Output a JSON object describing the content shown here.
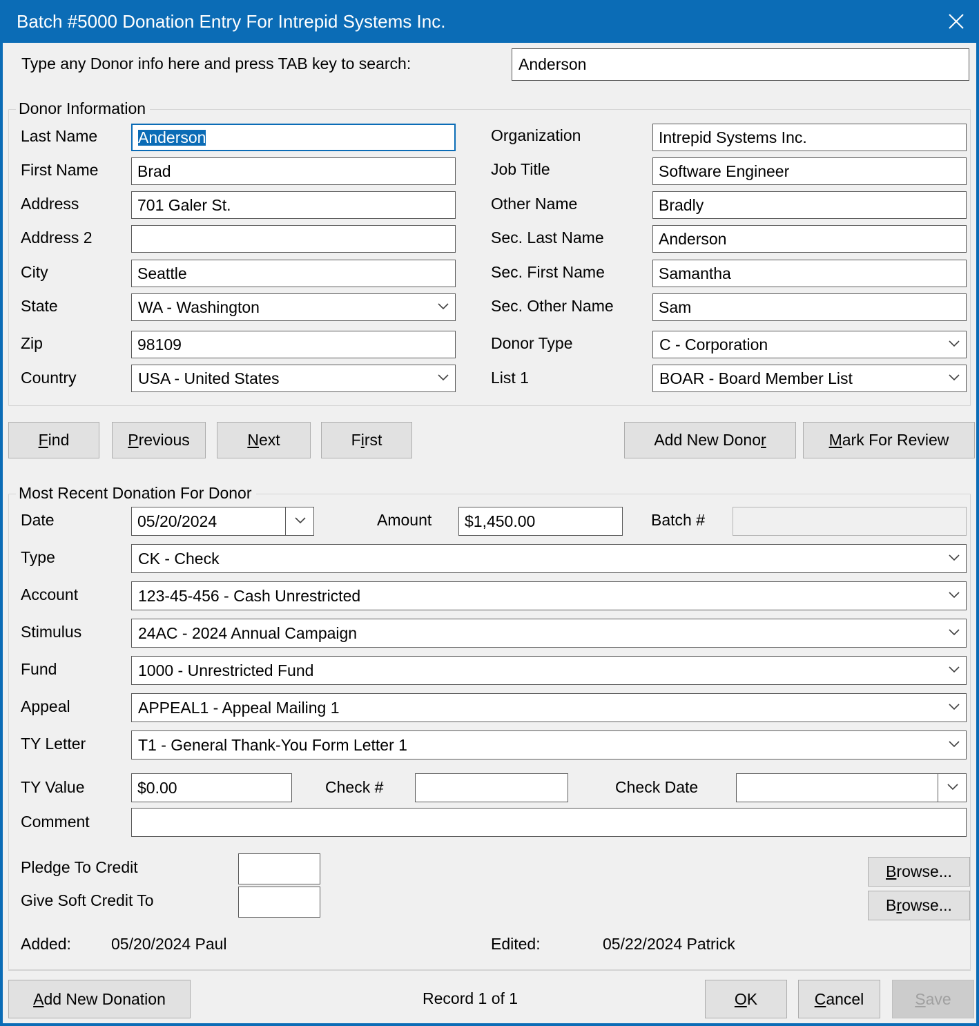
{
  "window": {
    "title": "Batch #5000 Donation Entry For Intrepid Systems Inc.",
    "close_icon": "close-icon",
    "accent_color": "#0b6cb6"
  },
  "search": {
    "label": "Type any Donor info here and press TAB key to search:",
    "value": "Anderson"
  },
  "donor_group": {
    "title": "Donor Information",
    "left_fields": [
      {
        "label": "Last Name",
        "value": "Anderson",
        "type": "text",
        "selected": true
      },
      {
        "label": "First Name",
        "value": "Brad",
        "type": "text"
      },
      {
        "label": "Address",
        "value": "701 Galer St.",
        "type": "text"
      },
      {
        "label": "Address 2",
        "value": "",
        "type": "text"
      },
      {
        "label": "City",
        "value": "Seattle",
        "type": "text"
      },
      {
        "label": "State",
        "value": "WA - Washington",
        "type": "combo"
      },
      {
        "label": "Zip",
        "value": "98109",
        "type": "text"
      },
      {
        "label": "Country",
        "value": "USA - United States",
        "type": "combo"
      }
    ],
    "right_fields": [
      {
        "label": "Organization",
        "value": "Intrepid Systems Inc.",
        "type": "text"
      },
      {
        "label": "Job Title",
        "value": "Software Engineer",
        "type": "text"
      },
      {
        "label": "Other Name",
        "value": "Bradly",
        "type": "text"
      },
      {
        "label": "Sec. Last Name",
        "value": "Anderson",
        "type": "text"
      },
      {
        "label": "Sec. First Name",
        "value": "Samantha",
        "type": "text"
      },
      {
        "label": "Sec. Other Name",
        "value": "Sam",
        "type": "text"
      },
      {
        "label": "Donor Type",
        "value": "C - Corporation",
        "type": "combo"
      },
      {
        "label": "List 1",
        "value": "BOAR - Board Member List",
        "type": "combo"
      }
    ]
  },
  "nav_buttons": [
    {
      "label": "Find",
      "accel": "F"
    },
    {
      "label": "Previous",
      "accel": "P"
    },
    {
      "label": "Next",
      "accel": "N"
    },
    {
      "label": "First",
      "accel": "i"
    }
  ],
  "donor_actions": [
    {
      "label": "Add New Donor",
      "accel": "r"
    },
    {
      "label": "Mark For Review",
      "accel": "M"
    }
  ],
  "donation_group": {
    "title": "Most Recent Donation For Donor",
    "date": {
      "label": "Date",
      "value": "05/20/2024"
    },
    "amount": {
      "label": "Amount",
      "value": "$1,450.00"
    },
    "batch": {
      "label": "Batch #",
      "value": "",
      "disabled": true
    },
    "type": {
      "label": "Type",
      "value": "CK - Check"
    },
    "account": {
      "label": "Account",
      "value": "123-45-456 - Cash Unrestricted"
    },
    "stimulus": {
      "label": "Stimulus",
      "value": "24AC - 2024 Annual Campaign"
    },
    "fund": {
      "label": "Fund",
      "value": "1000 - Unrestricted Fund"
    },
    "appeal": {
      "label": "Appeal",
      "value": "APPEAL1 - Appeal Mailing 1"
    },
    "ty_letter": {
      "label": "TY Letter",
      "value": "T1 - General Thank-You Form Letter 1"
    },
    "ty_value": {
      "label": "TY Value",
      "value": "$0.00"
    },
    "check_num": {
      "label": "Check #",
      "value": ""
    },
    "check_date": {
      "label": "Check Date",
      "value": ""
    },
    "comment": {
      "label": "Comment",
      "value": ""
    },
    "pledge": {
      "label": "Pledge To Credit",
      "value": "",
      "browse": "Browse...",
      "browse_accel": "B"
    },
    "soft_credit": {
      "label": "Give Soft Credit To",
      "value": "",
      "browse": "Browse...",
      "browse_accel": "r"
    },
    "added": {
      "label": "Added:",
      "value": "05/20/2024 Paul"
    },
    "edited": {
      "label": "Edited:",
      "value": "05/22/2024 Patrick"
    }
  },
  "footer": {
    "add_new_donation": {
      "label": "Add New Donation",
      "accel": "A"
    },
    "record_status": "Record 1 of 1",
    "ok": {
      "label": "OK",
      "accel": "O"
    },
    "cancel": {
      "label": "Cancel",
      "accel": "C"
    },
    "save": {
      "label": "Save",
      "accel": "S",
      "disabled": true
    }
  }
}
